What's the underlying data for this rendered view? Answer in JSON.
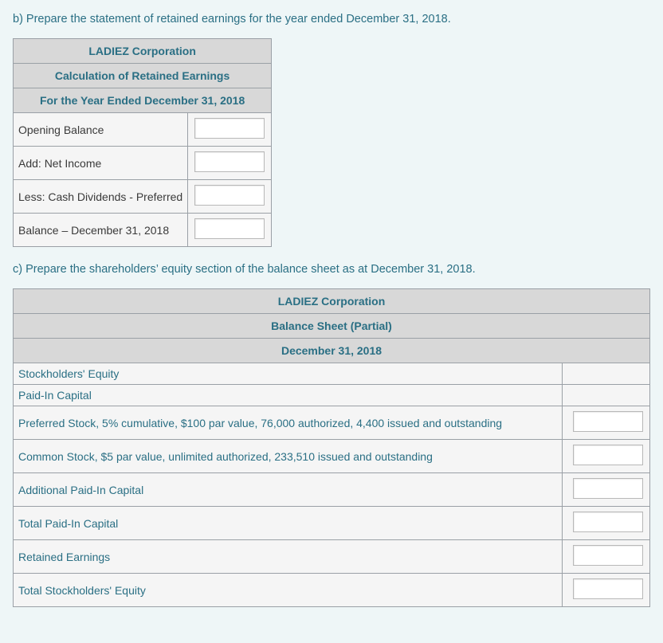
{
  "partB": {
    "prompt": "b) Prepare the statement of retained earnings for the year ended December 31, 2018.",
    "header1": "LADIEZ Corporation",
    "header2": "Calculation of Retained Earnings",
    "header3": "For the Year Ended December 31, 2018",
    "rows": {
      "opening": "Opening Balance",
      "addNetIncome": "Add: Net Income",
      "lessCashDiv": "Less: Cash Dividends - Preferred",
      "balance": "Balance – December 31, 2018"
    }
  },
  "partC": {
    "prompt": "c) Prepare the shareholders’ equity section of the balance sheet as at December 31, 2018.",
    "header1": "LADIEZ Corporation",
    "header2": "Balance Sheet (Partial)",
    "header3": "December 31, 2018",
    "rows": {
      "stockholdersEquity": "Stockholders' Equity",
      "paidInCapital": "Paid-In Capital",
      "preferredStock": "Preferred Stock, 5% cumulative, $100 par value, 76,000 authorized, 4,400 issued and outstanding",
      "commonStock": "Common Stock, $5 par value, unlimited authorized, 233,510 issued and outstanding",
      "addlPaidIn": "Additional Paid-In Capital",
      "totalPaidIn": "Total Paid-In Capital",
      "retainedEarnings": "Retained Earnings",
      "totalSE": "Total Stockholders' Equity"
    }
  }
}
